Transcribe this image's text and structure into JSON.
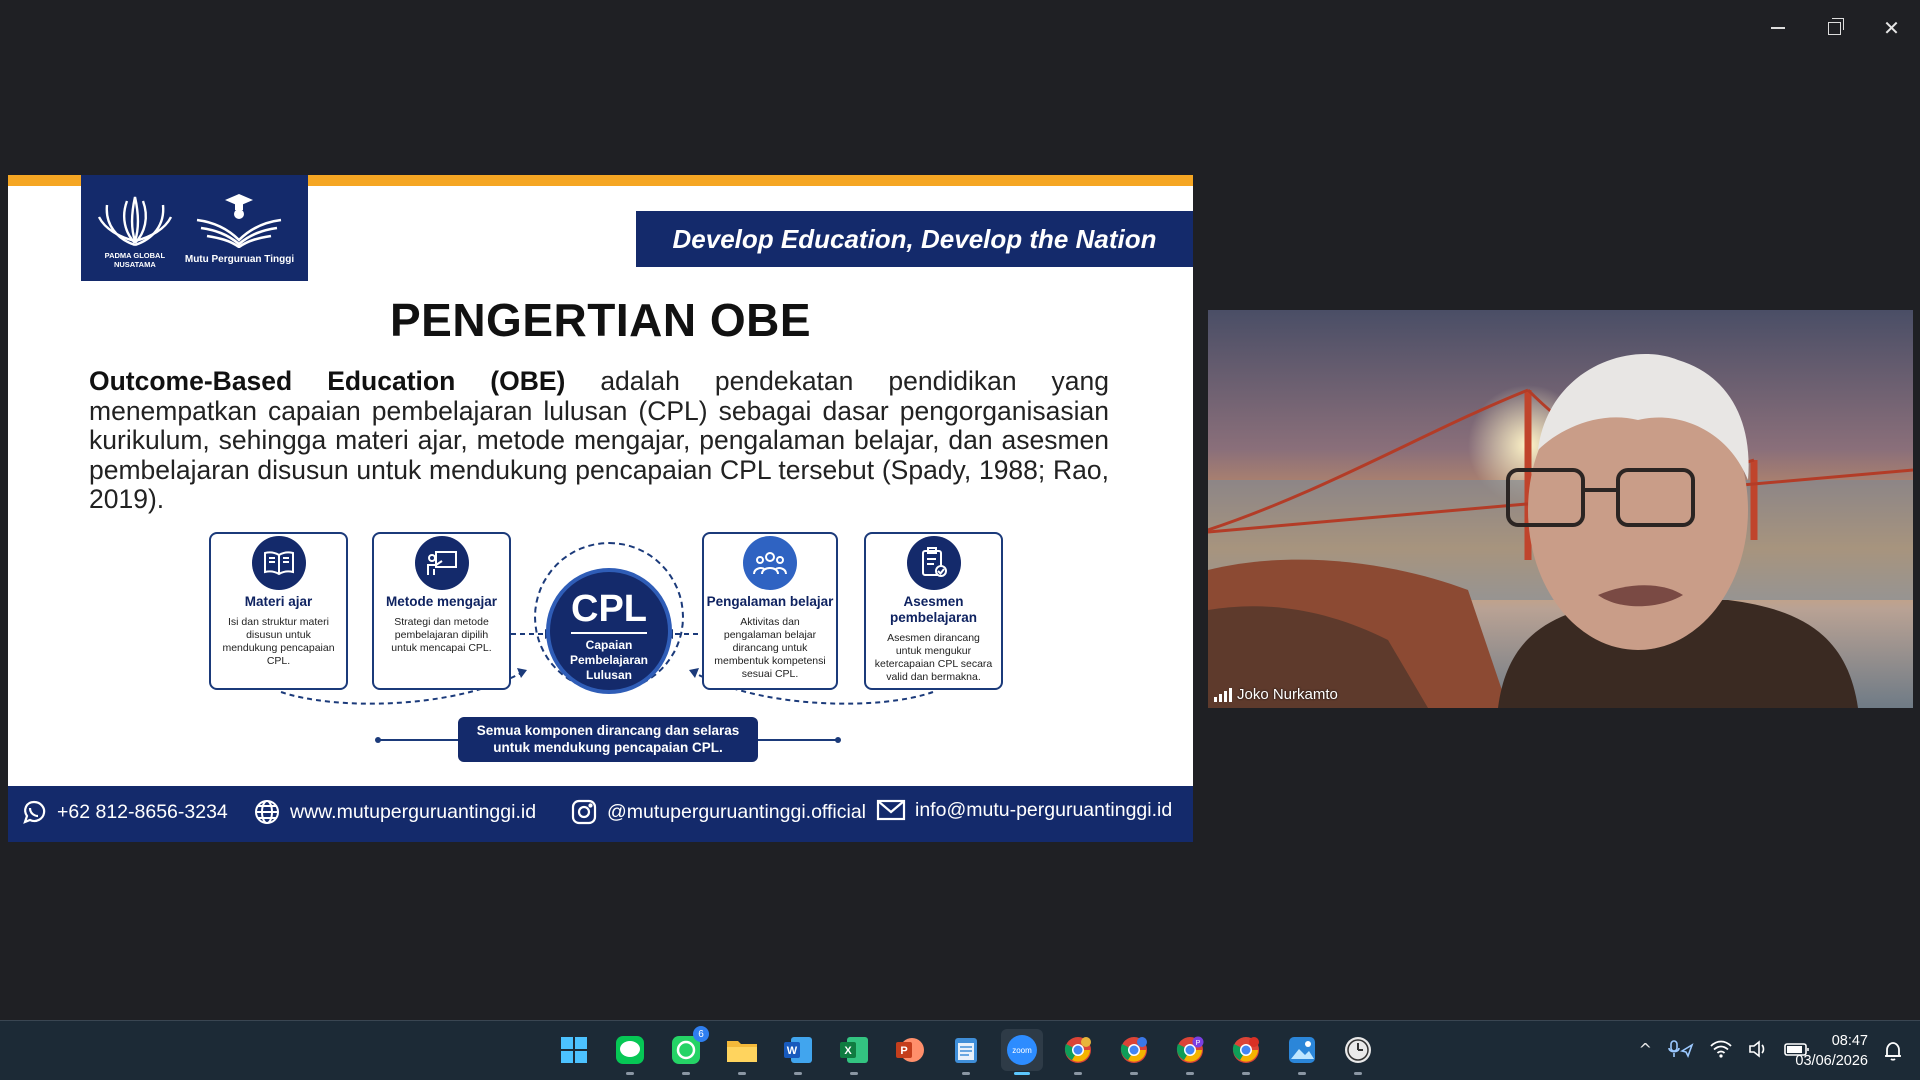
{
  "window": {
    "minimize": "—",
    "restore": "❐",
    "close": "✕"
  },
  "slide": {
    "logos": {
      "padma_caption_line1": "PADMA GLOBAL",
      "padma_caption_line2": "NUSATAMA",
      "mutu_caption": "Mutu Perguruan Tinggi"
    },
    "tagline": "Develop Education, Develop the Nation",
    "title": "PENGERTIAN OBE",
    "body_bold": "Outcome-Based Education (OBE)",
    "body_rest": " adalah pendekatan pendidikan yang menempatkan capaian pembelajaran lulusan (CPL) sebagai dasar pengorganisasian kurikulum, sehingga materi ajar, metode mengajar, pengalaman belajar, dan asesmen pembelajaran disusun untuk mendukung pencapaian CPL tersebut (Spady, 1988; Rao, 2019).",
    "cards": [
      {
        "title": "Materi ajar",
        "desc": "Isi dan struktur materi disusun untuk mendukung pencapaian CPL.",
        "icon": "book-icon"
      },
      {
        "title": "Metode mengajar",
        "desc": "Strategi dan metode pembelajaran dipilih untuk mencapai CPL.",
        "icon": "teacher-board-icon"
      },
      {
        "title": "Pengalaman belajar",
        "desc": "Aktivitas dan pengalaman belajar dirancang untuk membentuk kompetensi sesuai CPL.",
        "icon": "group-people-icon"
      },
      {
        "title": "Asesmen pembelajaran",
        "desc": "Asesmen dirancang untuk mengukur ketercapaian CPL secara valid dan bermakna.",
        "icon": "checklist-icon"
      }
    ],
    "cpl": {
      "abbr": "CPL",
      "line1": "Capaian",
      "line2": "Pembelajaran",
      "line3": "Lulusan"
    },
    "note": {
      "line1": "Semua komponen dirancang dan selaras",
      "line2": "untuk mendukung pencapaian CPL."
    },
    "footer": {
      "phone": "+62 812-8656-3234",
      "website": "www.mutuperguruantinggi.id",
      "instagram": "@mutuperguruantinggi.official",
      "email": "info@mutu-perguruantinggi.id"
    }
  },
  "video": {
    "participant_name": "Joko Nurkamto"
  },
  "taskbar": {
    "apps": [
      {
        "name": "windows-start-icon",
        "color": "#3aa0ff"
      },
      {
        "name": "line-app-icon",
        "color": "#06c755"
      },
      {
        "name": "whatsapp-icon",
        "color": "#25d366",
        "badge": "6"
      },
      {
        "name": "file-explorer-icon",
        "color": "#f7c548"
      },
      {
        "name": "word-icon",
        "color": "#2b62c9"
      },
      {
        "name": "excel-icon",
        "color": "#1f8f4e"
      },
      {
        "name": "powerpoint-icon",
        "color": "#d24726"
      },
      {
        "name": "notepad-icon",
        "color": "#4fa3e0"
      },
      {
        "name": "zoom-icon",
        "color": "#2d8cff",
        "label": "zoom"
      },
      {
        "name": "chrome-icon-1",
        "color": "#e8b43a"
      },
      {
        "name": "chrome-icon-2",
        "color": "#3b78e7"
      },
      {
        "name": "chrome-icon-3",
        "color": "#7b3fe4",
        "badge_letter": "P"
      },
      {
        "name": "chrome-icon-4",
        "color": "#d93025"
      },
      {
        "name": "photos-icon",
        "color": "#3c8fe0"
      },
      {
        "name": "clock-app-icon",
        "color": "#e9e9e9"
      }
    ],
    "tray": {
      "chevron": "^",
      "wifi": "wifi",
      "volume": "speaker",
      "battery": "battery"
    },
    "time": "08:47",
    "date": "03/06/2026"
  }
}
